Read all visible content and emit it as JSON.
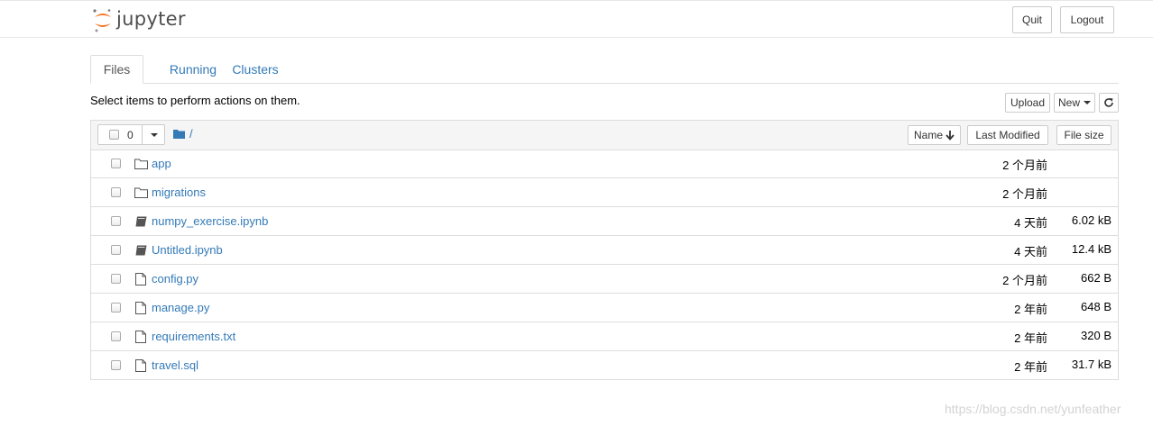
{
  "header": {
    "logo_text": "jupyter",
    "quit_label": "Quit",
    "logout_label": "Logout"
  },
  "tabs": [
    {
      "label": "Files",
      "active": true
    },
    {
      "label": "Running"
    },
    {
      "label": "Clusters"
    }
  ],
  "toolbar": {
    "instruction": "Select items to perform actions on them.",
    "upload_label": "Upload",
    "new_label": "New",
    "refresh_icon": "refresh-icon"
  },
  "list_header": {
    "selected_count": "0",
    "breadcrumb": "/",
    "sort_name_label": "Name",
    "sort_modified_label": "Last Modified",
    "sort_size_label": "File size"
  },
  "files": [
    {
      "name": "app",
      "type": "folder",
      "modified": "2 个月前",
      "size": ""
    },
    {
      "name": "migrations",
      "type": "folder",
      "modified": "2 个月前",
      "size": ""
    },
    {
      "name": "numpy_exercise.ipynb",
      "type": "notebook",
      "modified": "4 天前",
      "size": "6.02 kB"
    },
    {
      "name": "Untitled.ipynb",
      "type": "notebook",
      "modified": "4 天前",
      "size": "12.4 kB"
    },
    {
      "name": "config.py",
      "type": "file",
      "modified": "2 个月前",
      "size": "662 B"
    },
    {
      "name": "manage.py",
      "type": "file",
      "modified": "2 年前",
      "size": "648 B"
    },
    {
      "name": "requirements.txt",
      "type": "file",
      "modified": "2 年前",
      "size": "320 B"
    },
    {
      "name": "travel.sql",
      "type": "file",
      "modified": "2 年前",
      "size": "31.7 kB"
    }
  ],
  "watermark": "https://blog.csdn.net/yunfeather",
  "colors": {
    "link": "#337ab7",
    "logo_orange": "#f37726",
    "border": "#dddddd"
  }
}
